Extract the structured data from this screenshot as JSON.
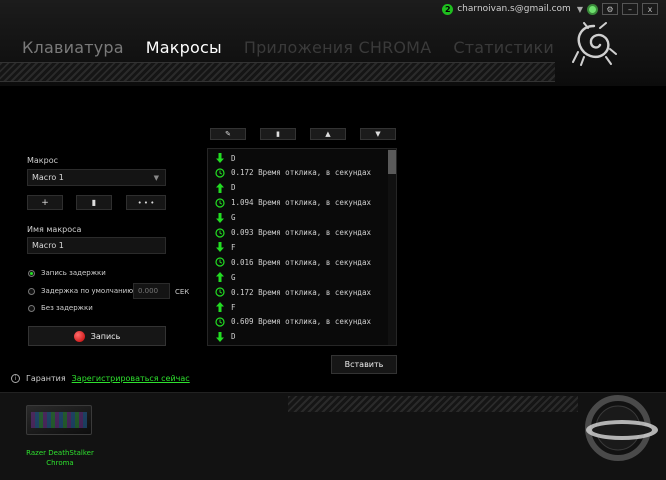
{
  "header": {
    "tabs": [
      {
        "label": "Клавиатура",
        "state": "inactive"
      },
      {
        "label": "Макросы",
        "state": "active"
      },
      {
        "label": "Приложения CHROMA",
        "state": "disabled"
      },
      {
        "label": "Статистики",
        "state": "disabled"
      }
    ],
    "user_badge": "2",
    "user_email": "charnoivan.s@gmail.com",
    "settings_icon": "gear-icon",
    "minimize_label": "–",
    "close_label": "x"
  },
  "macro_panel": {
    "macro_label": "Макрос",
    "macro_select_value": "Macro 1",
    "add_label": "+",
    "delete_icon": "trash-icon",
    "more_label": "• • •",
    "name_label": "Имя макроса",
    "name_value": "Macro 1",
    "delay_options": [
      {
        "label": "Запись задержки",
        "selected": true
      },
      {
        "label": "Задержка по умолчанию",
        "selected": false
      },
      {
        "label": "Без задержки",
        "selected": false
      }
    ],
    "default_delay_placeholder": "0.000",
    "default_delay_unit": "СЕК",
    "record_label": "Запись"
  },
  "toolbar": {
    "edit_icon": "pencil-icon",
    "delete_icon": "trash-icon",
    "move_up_icon": "triangle-up-icon",
    "move_down_icon": "triangle-down-icon"
  },
  "macro_events": [
    {
      "type": "key-down",
      "text": "D"
    },
    {
      "type": "delay",
      "text": "0.172 Время отклика, в секундах"
    },
    {
      "type": "key-up",
      "text": "D"
    },
    {
      "type": "delay",
      "text": "1.094 Время отклика, в секундах"
    },
    {
      "type": "key-down",
      "text": "G"
    },
    {
      "type": "delay",
      "text": "0.093 Время отклика, в секундах"
    },
    {
      "type": "key-down",
      "text": "F"
    },
    {
      "type": "delay",
      "text": "0.016 Время отклика, в секундах"
    },
    {
      "type": "key-up",
      "text": "G"
    },
    {
      "type": "delay",
      "text": "0.172 Время отклика, в секундах"
    },
    {
      "type": "key-up",
      "text": "F"
    },
    {
      "type": "delay",
      "text": "0.609 Время отклика, в секундах"
    },
    {
      "type": "key-down",
      "text": "D"
    }
  ],
  "insert_label": "Вставить",
  "warranty": {
    "label": "Гарантия",
    "link": "Зарегистрироваться сейчас"
  },
  "device": {
    "name_line1": "Razer DeathStalker",
    "name_line2": "Chroma"
  },
  "colors": {
    "accent": "#22dd22",
    "background": "#000000",
    "record": "#dd0000"
  }
}
